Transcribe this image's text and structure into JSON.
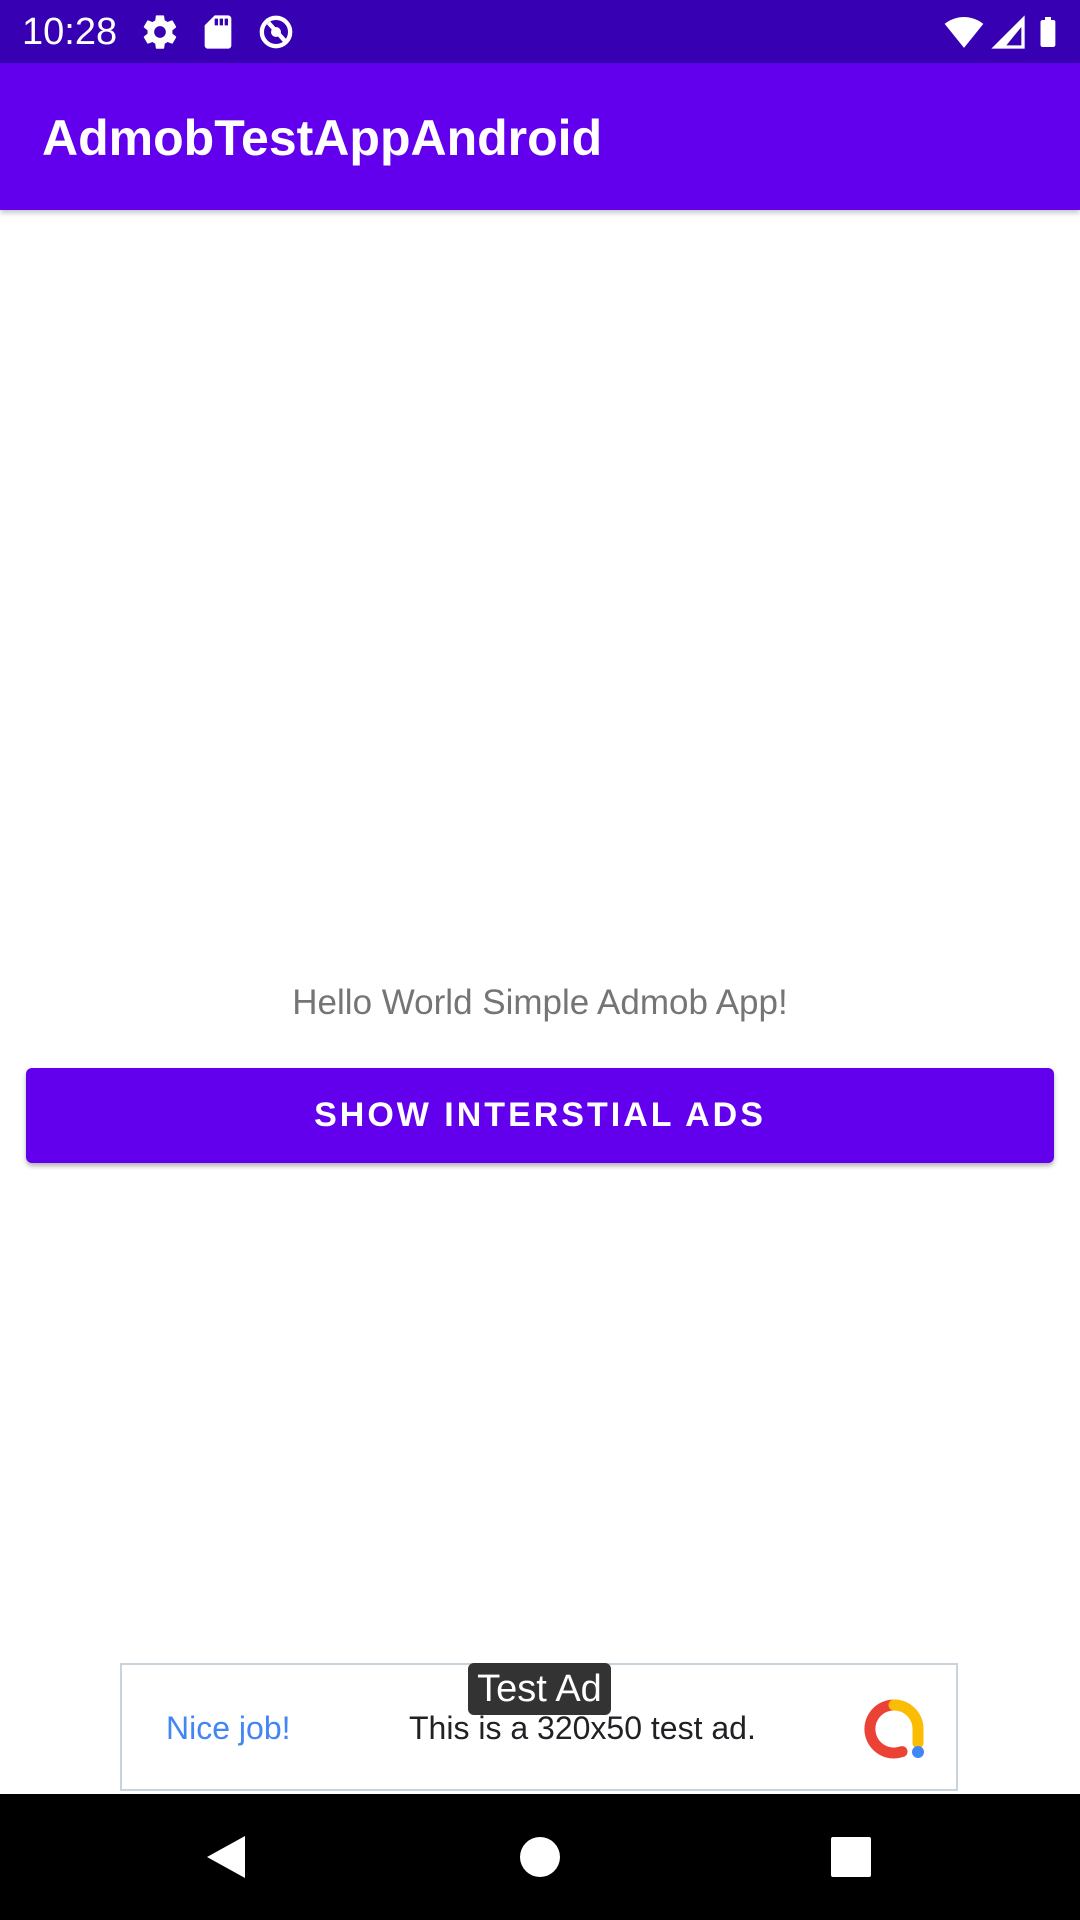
{
  "status_bar": {
    "time": "10:28",
    "icons": [
      "settings-icon",
      "sd-card-icon",
      "data-saver-icon",
      "wifi-icon",
      "cell-signal-icon",
      "battery-icon"
    ]
  },
  "app_bar": {
    "title": "AdmobTestAppAndroid"
  },
  "content": {
    "message": "Hello World Simple Admob App!",
    "button_label": "SHOW INTERSTIAL ADS"
  },
  "ad_banner": {
    "badge": "Test Ad",
    "headline": "Nice job!",
    "body": "This is a 320x50 test ad.",
    "logo": "admob-logo-icon"
  },
  "navigation_bar": {
    "buttons": [
      "back-icon",
      "home-icon",
      "recents-icon"
    ]
  },
  "colors": {
    "status_bar": "#3700b3",
    "primary": "#6200ee",
    "text_secondary": "#757575",
    "ad_headline": "#4285f4"
  }
}
